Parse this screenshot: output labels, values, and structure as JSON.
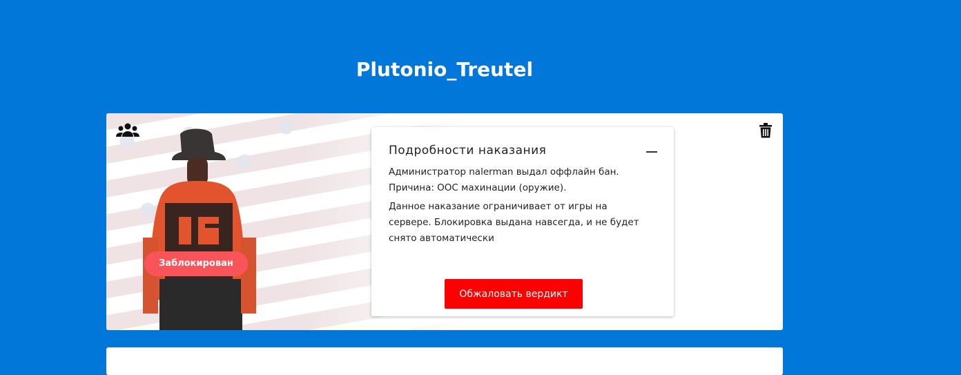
{
  "page": {
    "title": "Plutonio_Treutel"
  },
  "punishment_card": {
    "status_badge": "Заблокирован",
    "details": {
      "title": "Подробности наказания",
      "line1": "Администратор nalerman выдал оффлайн бан.",
      "line2": "Причина: OOC махинации (оружие).",
      "description": "Данное наказание ограничивает от игры на сервере. Блокировка выдана навсегда, и не будет снято автоматически",
      "appeal_button": "Обжаловать вердикт"
    },
    "icons": {
      "group": "users-group-icon",
      "delete": "trash-icon",
      "collapse": "minus-icon"
    }
  },
  "colors": {
    "background": "#0077d9",
    "badge": "#f8545a",
    "appeal_button": "#ff0000"
  }
}
